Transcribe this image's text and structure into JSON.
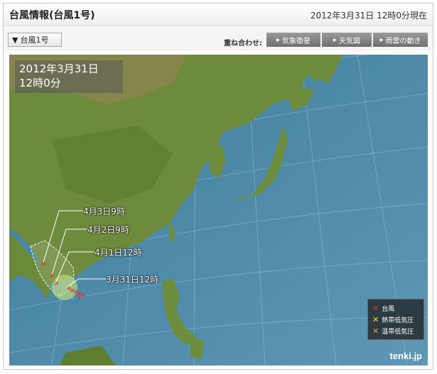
{
  "header": {
    "title": "台風情報(台風1号)",
    "timestamp": "2012年3月31日 12時0分現在"
  },
  "toolbar": {
    "storm_selector": "台風1号",
    "overlay_label": "重ね合わせ:",
    "buttons": [
      "気象衛星",
      "天気図",
      "雨雲の動き"
    ]
  },
  "map": {
    "datetime_line1": "2012年3月31日",
    "datetime_line2": "12時0分",
    "track_labels": [
      "4月3日9時",
      "4月2日9時",
      "4月1日12時",
      "3月31日12時"
    ],
    "brand": "tenki.jp"
  },
  "legend": {
    "items": [
      {
        "label": "台風",
        "color": "#e53030"
      },
      {
        "label": "熱帯低気圧",
        "color": "#f0e020"
      },
      {
        "label": "温帯低気圧",
        "color": "#f0a020"
      }
    ]
  }
}
